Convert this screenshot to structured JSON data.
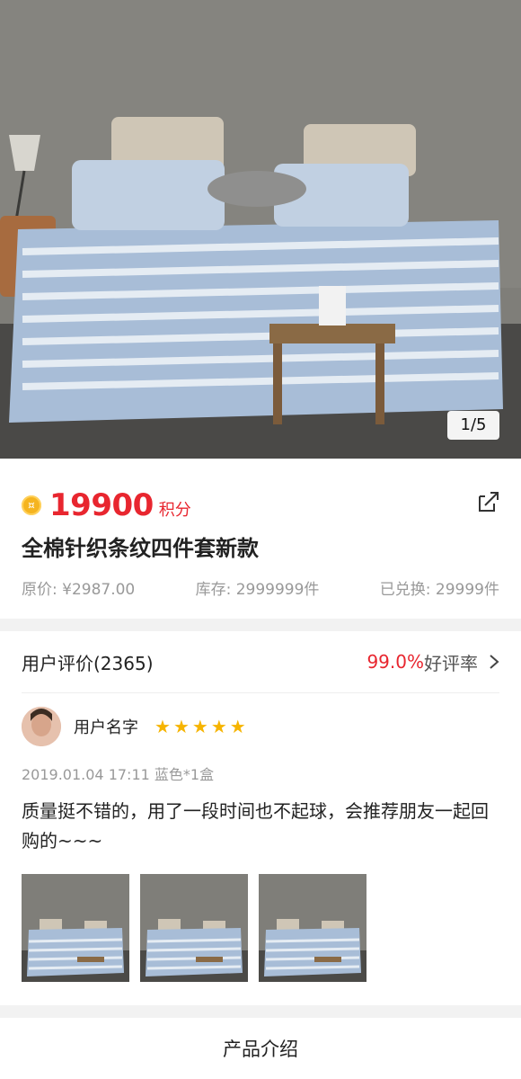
{
  "hero": {
    "pager": "1/5"
  },
  "product": {
    "points": "19900",
    "points_unit": "积分",
    "coin_glyph": "¤",
    "title": "全棉针织条纹四件套新款",
    "original_price": "原价: ¥2987.00",
    "stock": "库存: 2999999件",
    "redeemed": "已兑换: 29999件"
  },
  "reviews": {
    "title": "用户评价(2365)",
    "rate_value": "99.0%",
    "rate_label": "好评率",
    "user_name": "用户名字",
    "stars": [
      "★",
      "★",
      "★",
      "★",
      "★"
    ],
    "meta": "2019.01.04 17:11  蓝色*1盒",
    "text": "质量挺不错的，用了一段时间也不起球，会推荐朋友一起回购的~~~"
  },
  "intro": {
    "label": "产品介绍"
  },
  "icons": {
    "share": "share-icon",
    "chevron": "chevron-right-icon"
  },
  "colors": {
    "accent": "#e8262f",
    "star": "#f6b400",
    "coin": "#f5b41f"
  }
}
